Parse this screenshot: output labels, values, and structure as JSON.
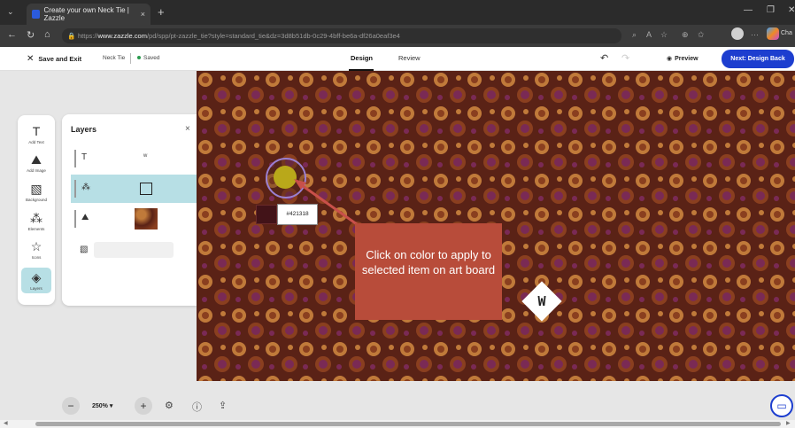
{
  "browser": {
    "tab_title": "Create your own Neck Tie | Zazzle",
    "tab_close": "×",
    "new_tab": "+",
    "tab_menu": "⌄",
    "url_prefix": "https://",
    "url_host": "www.zazzle.com",
    "url_path": "/pd/spp/pt-zazzle_tie?style=standard_tie&dz=3d8b51db-0c29-4bff-be6a-df26a0eaf3e4",
    "copilot_label": "Cha"
  },
  "header": {
    "save_exit": "Save and Exit",
    "product_name": "Neck Tie",
    "saved_status": "Saved",
    "tabs": [
      "Design",
      "Review"
    ],
    "preview": "Preview",
    "next_button": "Next: Design Back"
  },
  "toolbar": {
    "items": [
      {
        "label": "Add Text",
        "icon": "text-icon",
        "glyph": "T"
      },
      {
        "label": "Add Image",
        "icon": "image-upload-icon",
        "glyph": "⛰"
      },
      {
        "label": "Background",
        "icon": "background-icon",
        "glyph": "▧"
      },
      {
        "label": "Elements",
        "icon": "elements-icon",
        "glyph": "⁂"
      },
      {
        "label": "Icons",
        "icon": "star-icon",
        "glyph": "☆"
      },
      {
        "label": "Layers",
        "icon": "layers-icon",
        "glyph": "◈"
      }
    ]
  },
  "layers_panel": {
    "title": "Layers",
    "close": "×",
    "rows": [
      {
        "type": "text",
        "glyph": "T",
        "preview": "w"
      },
      {
        "type": "shape",
        "glyph": "⁂",
        "selected": true
      },
      {
        "type": "image",
        "glyph": "⛰"
      },
      {
        "type": "background",
        "glyph": "▧"
      }
    ]
  },
  "color_picker": {
    "hex": "#421318",
    "swatch_color": "#421318",
    "picked_color": "#b9a81a"
  },
  "callout": {
    "text": "Click on color to apply to selected item on art board"
  },
  "artboard": {
    "element_letter": "W",
    "pattern_colors": [
      "#5a2216",
      "#8a3f1f",
      "#c07a3a",
      "#7a2a55"
    ]
  },
  "bottom": {
    "zoom": "250%",
    "zoom_out": "−",
    "zoom_in": "+"
  },
  "colors": {
    "accent": "#1d3ecf",
    "selection": "#b7dfe5",
    "callout": "#b84c3a"
  }
}
